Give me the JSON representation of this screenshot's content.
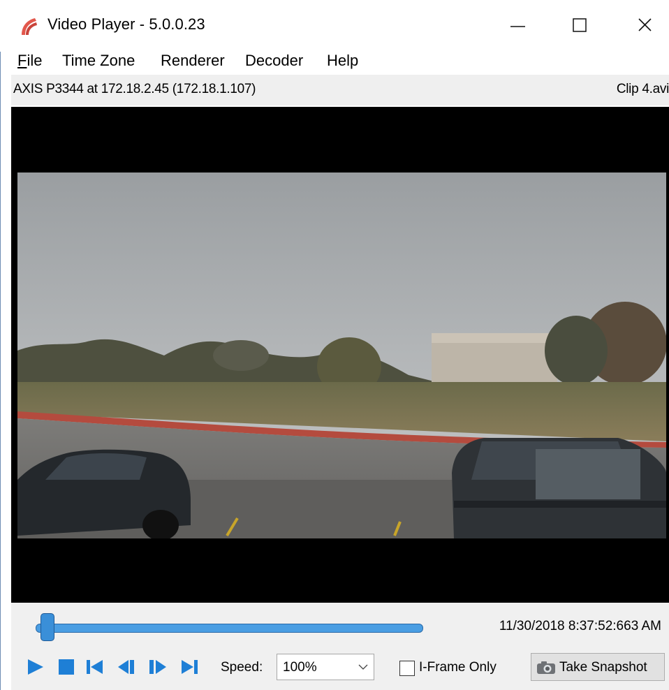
{
  "window": {
    "title": "Video Player - 5.0.0.23",
    "controls": {
      "minimize": "minimize-icon",
      "maximize": "maximize-icon",
      "close": "close-icon"
    }
  },
  "menu": {
    "file_accel": "F",
    "file_rest": "ile",
    "items": [
      "Time Zone",
      "Renderer",
      "Decoder",
      "Help"
    ]
  },
  "info": {
    "camera": "AXIS P3344 at 172.18.2.45 (172.18.1.107)",
    "clip": "Clip 4.avi"
  },
  "playback": {
    "timestamp": "11/30/2018 8:37:52:663 AM",
    "position_fraction": 0.03,
    "speed_label": "Speed:",
    "speed_value": "100%",
    "iframe_label": "I-Frame Only",
    "iframe_checked": false,
    "snapshot_label": "Take Snapshot",
    "buttons": [
      "play-icon",
      "stop-icon",
      "first-frame-icon",
      "step-back-icon",
      "step-forward-icon",
      "last-frame-icon"
    ]
  },
  "colors": {
    "accent": "#1e7fd6",
    "panel": "#f0f0f0",
    "infobar": "#efefef"
  }
}
